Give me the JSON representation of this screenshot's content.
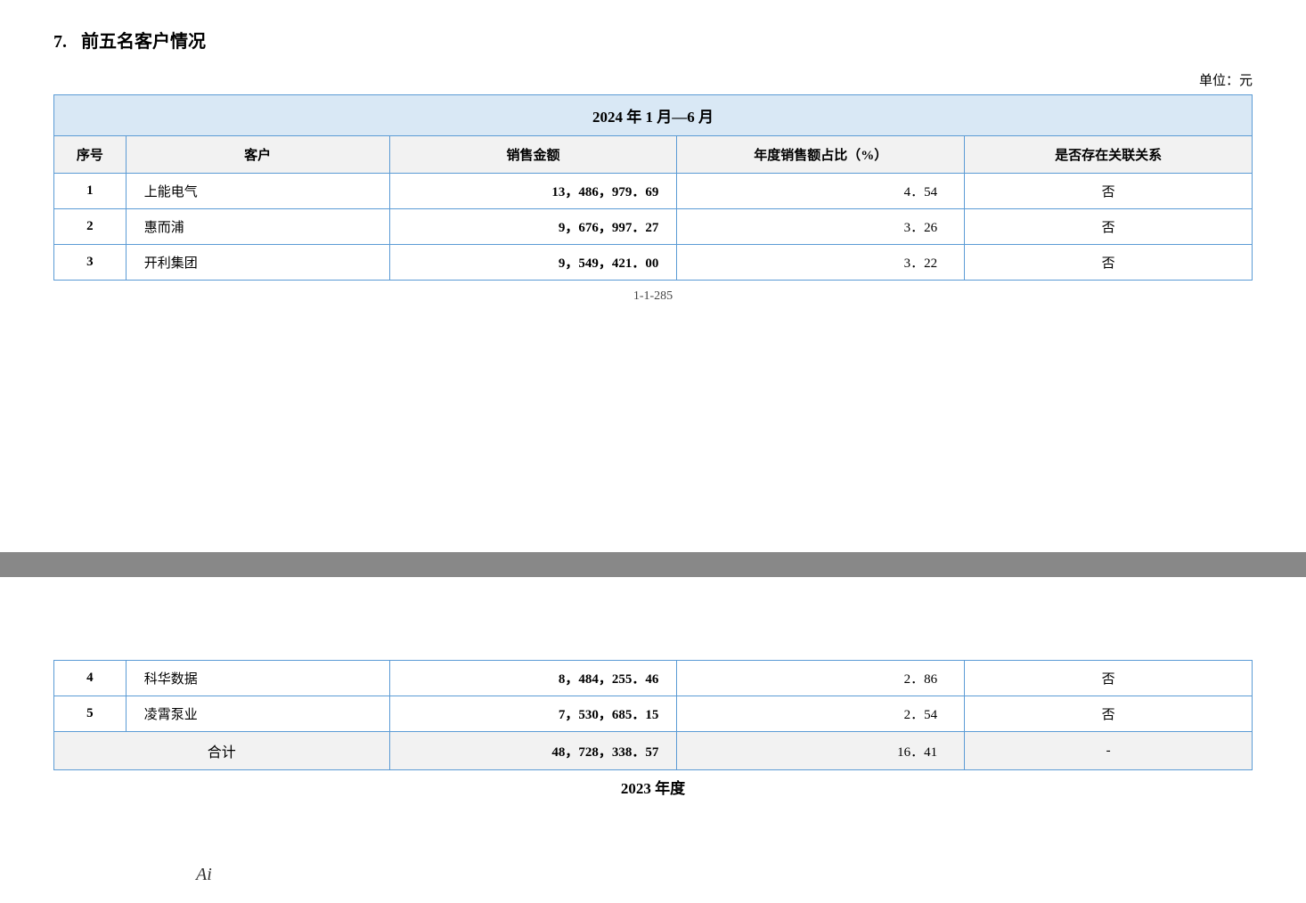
{
  "section": {
    "number": "7.",
    "title": "前五名客户情况"
  },
  "unit": "单位：元",
  "period_2024": "2024 年 1 月—6 月",
  "table_headers": {
    "serial": "序号",
    "customer": "客户",
    "sales_amount": "销售金额",
    "sales_ratio": "年度销售额占比（%）",
    "related": "是否存在关联关系"
  },
  "rows_top": [
    {
      "serial": "1",
      "customer": "上能电气",
      "sales_amount": "13，486，979．69",
      "sales_ratio": "4．54",
      "related": "否"
    },
    {
      "serial": "2",
      "customer": "惠而浦",
      "sales_amount": "9，676，997．27",
      "sales_ratio": "3．26",
      "related": "否"
    },
    {
      "serial": "3",
      "customer": "开利集团",
      "sales_amount": "9，549，421．00",
      "sales_ratio": "3．22",
      "related": "否"
    }
  ],
  "page_indicator": "1-1-285",
  "rows_bottom": [
    {
      "serial": "4",
      "customer": "科华数据",
      "sales_amount": "8，484，255．46",
      "sales_ratio": "2．86",
      "related": "否"
    },
    {
      "serial": "5",
      "customer": "凌霄泵业",
      "sales_amount": "7，530，685．15",
      "sales_ratio": "2．54",
      "related": "否"
    }
  ],
  "total_row": {
    "label": "合计",
    "sales_amount": "48，728，338．57",
    "sales_ratio": "16．41",
    "related": "-"
  },
  "next_period_label": "2023 年度",
  "ai_text": "Ai"
}
